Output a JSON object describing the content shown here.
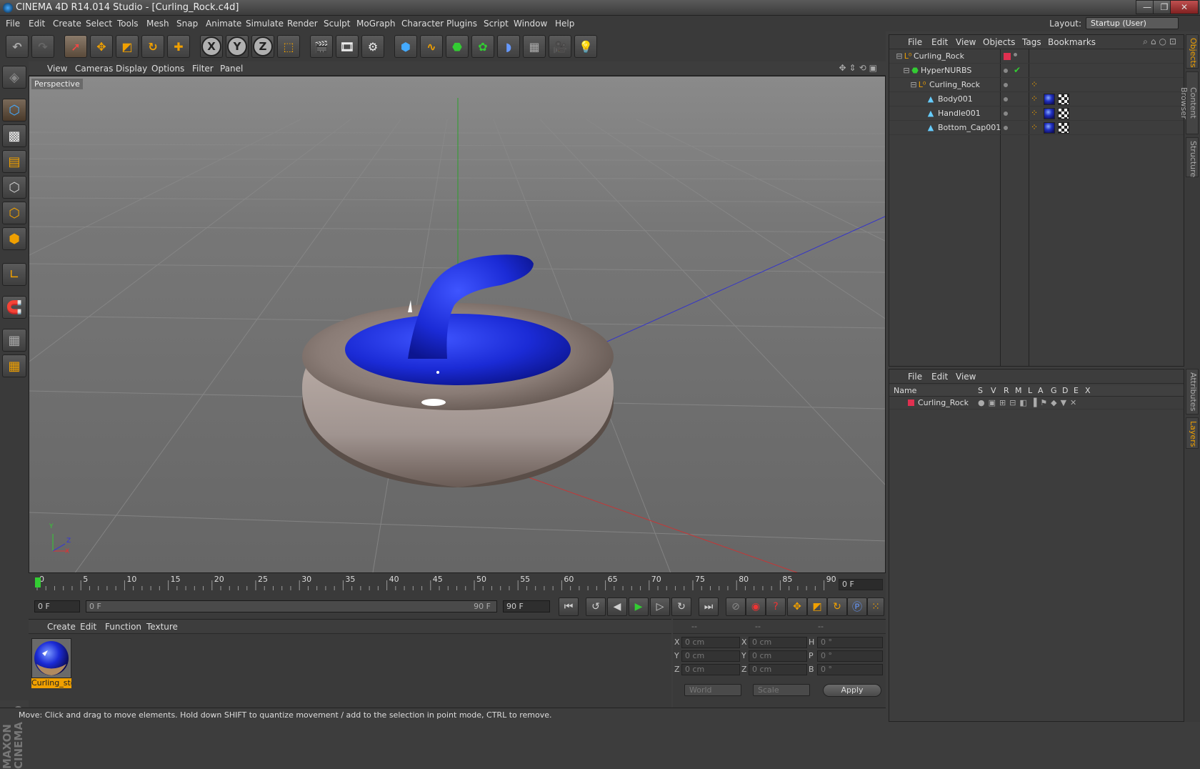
{
  "window": {
    "title": "CINEMA 4D R14.014 Studio - [Curling_Rock.c4d]",
    "controls": [
      "—",
      "❐",
      "✕"
    ]
  },
  "menu": [
    "File",
    "Edit",
    "Create",
    "Select",
    "Tools",
    "Mesh",
    "Snap",
    "Animate",
    "Simulate",
    "Render",
    "Sculpt",
    "MoGraph",
    "Character",
    "Plugins",
    "Script",
    "Window",
    "Help"
  ],
  "layout": {
    "label": "Layout:",
    "value": "Startup (User)"
  },
  "viewport": {
    "menu": [
      "View",
      "Cameras",
      "Display",
      "Options",
      "Filter",
      "Panel"
    ],
    "label": "Perspective",
    "axes": {
      "x": "X",
      "y": "Y",
      "z": "Z"
    }
  },
  "timeline": {
    "ticks": [
      "0",
      "5",
      "10",
      "15",
      "20",
      "25",
      "30",
      "35",
      "40",
      "45",
      "50",
      "55",
      "60",
      "65",
      "70",
      "75",
      "80",
      "85",
      "90"
    ],
    "current_frame": "0 F",
    "start": "0 F",
    "range_start": "0 F",
    "range_end": "90 F",
    "end": "90 F"
  },
  "materials": {
    "menu": [
      "Create",
      "Edit",
      "Function",
      "Texture"
    ],
    "items": [
      {
        "name": "Curling_sto"
      }
    ]
  },
  "coordinates": {
    "headers": [
      "--",
      "--",
      "--"
    ],
    "rows": [
      {
        "l1": "X",
        "v1": "0 cm",
        "l2": "X",
        "v2": "0 cm",
        "l3": "H",
        "v3": "0 °"
      },
      {
        "l1": "Y",
        "v1": "0 cm",
        "l2": "Y",
        "v2": "0 cm",
        "l3": "P",
        "v3": "0 °"
      },
      {
        "l1": "Z",
        "v1": "0 cm",
        "l2": "Z",
        "v2": "0 cm",
        "l3": "B",
        "v3": "0 °"
      }
    ],
    "mode1": "World",
    "mode2": "Scale",
    "apply": "Apply"
  },
  "status": "Move: Click and drag to move elements. Hold down SHIFT to quantize movement / add to the selection in point mode, CTRL to remove.",
  "objects": {
    "menu": [
      "File",
      "Edit",
      "View",
      "Objects",
      "Tags",
      "Bookmarks"
    ],
    "rows": [
      {
        "name": "Curling_Rock",
        "depth": 0,
        "icon": "null-icon"
      },
      {
        "name": "HyperNURBS",
        "depth": 1,
        "icon": "hypernurbs-icon"
      },
      {
        "name": "Curling_Rock",
        "depth": 2,
        "icon": "null-icon"
      },
      {
        "name": "Body001",
        "depth": 3,
        "icon": "polygon-icon"
      },
      {
        "name": "Handle001",
        "depth": 3,
        "icon": "polygon-icon"
      },
      {
        "name": "Bottom_Cap001",
        "depth": 3,
        "icon": "polygon-icon"
      }
    ]
  },
  "layers": {
    "menu": [
      "File",
      "Edit",
      "View"
    ],
    "columns": [
      "Name",
      "S",
      "V",
      "R",
      "M",
      "L",
      "A",
      "G",
      "D",
      "E",
      "X"
    ],
    "rows": [
      {
        "name": "Curling_Rock",
        "color": "#e03050"
      }
    ]
  },
  "right_tabs": [
    "Objects",
    "Content Browser",
    "Structure",
    "Attributes",
    "Layers"
  ],
  "colors": {
    "accent": "#f0a000",
    "handle": "#1b2bd6",
    "layer": "#e03050"
  }
}
